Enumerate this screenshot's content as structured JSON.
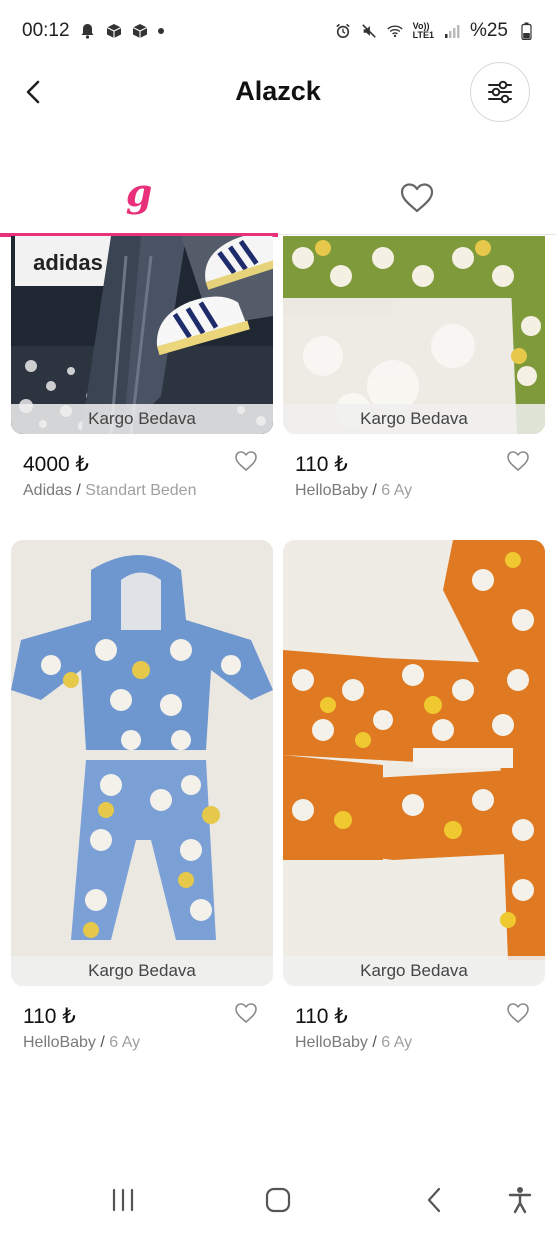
{
  "status": {
    "time": "00:12",
    "battery": "%25",
    "lte_top": "Vo))",
    "lte_bottom": "LTE1"
  },
  "header": {
    "title": "Alazck"
  },
  "tabs": {
    "brand_glyph": "g"
  },
  "colors": {
    "accent": "#e8317a"
  },
  "products": [
    {
      "price": "4000 ₺",
      "brand": "Adidas",
      "separator": "/",
      "size": "Standart Beden",
      "cargo": "Kargo Bedava",
      "favorited": false,
      "image": "adidas-tracksuit-and-sneakers-photo"
    },
    {
      "price": "110 ₺",
      "brand": "HelloBaby",
      "separator": "/",
      "size": "6 Ay",
      "cargo": "Kargo Bedava",
      "favorited": false,
      "image": "green-baby-pajama-photo"
    },
    {
      "price": "110 ₺",
      "brand": "HelloBaby",
      "separator": "/",
      "size": "6 Ay",
      "cargo": "Kargo Bedava",
      "favorited": false,
      "image": "blue-baby-pajama-set-photo"
    },
    {
      "price": "110 ₺",
      "brand": "HelloBaby",
      "separator": "/",
      "size": "6 Ay",
      "cargo": "Kargo Bedava",
      "favorited": false,
      "image": "orange-baby-pajama-photo"
    }
  ],
  "icons": {
    "back": "chevron-left-icon",
    "filter": "sliders-icon",
    "favorites_tab": "heart-outline-icon",
    "nav": [
      "recent-apps-icon",
      "home-icon",
      "back-icon",
      "accessibility-icon"
    ]
  }
}
